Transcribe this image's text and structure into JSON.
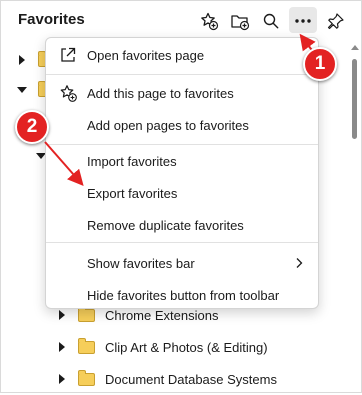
{
  "header": {
    "title": "Favorites",
    "icons": [
      "add-favorite-icon",
      "add-folder-icon",
      "search-icon",
      "more-options-icon",
      "pin-icon"
    ]
  },
  "tree": {
    "items": [
      {
        "label": "Chrome Extensions",
        "icon": "folder-icon"
      },
      {
        "label": "Clip Art & Photos (& Editing)",
        "icon": "folder-icon"
      },
      {
        "label": "Document Database Systems",
        "icon": "folder-icon"
      }
    ]
  },
  "menu": {
    "items": [
      {
        "label": "Open favorites page",
        "icon": "open-external-icon"
      },
      {
        "label": "Add this page to favorites",
        "icon": "star-add-icon"
      },
      {
        "label": "Add open pages to favorites"
      },
      {
        "label": "Import favorites"
      },
      {
        "label": "Export favorites"
      },
      {
        "label": "Remove duplicate favorites"
      },
      {
        "label": "Show favorites bar",
        "icon": "chevron-right-icon"
      },
      {
        "label": "Hide favorites button from toolbar"
      }
    ]
  },
  "annotations": {
    "badge1": "1",
    "badge2": "2",
    "color": "#e32222"
  },
  "colors": {
    "folder": "#f6ce5a",
    "menu_hover": "#e8e8e8"
  }
}
